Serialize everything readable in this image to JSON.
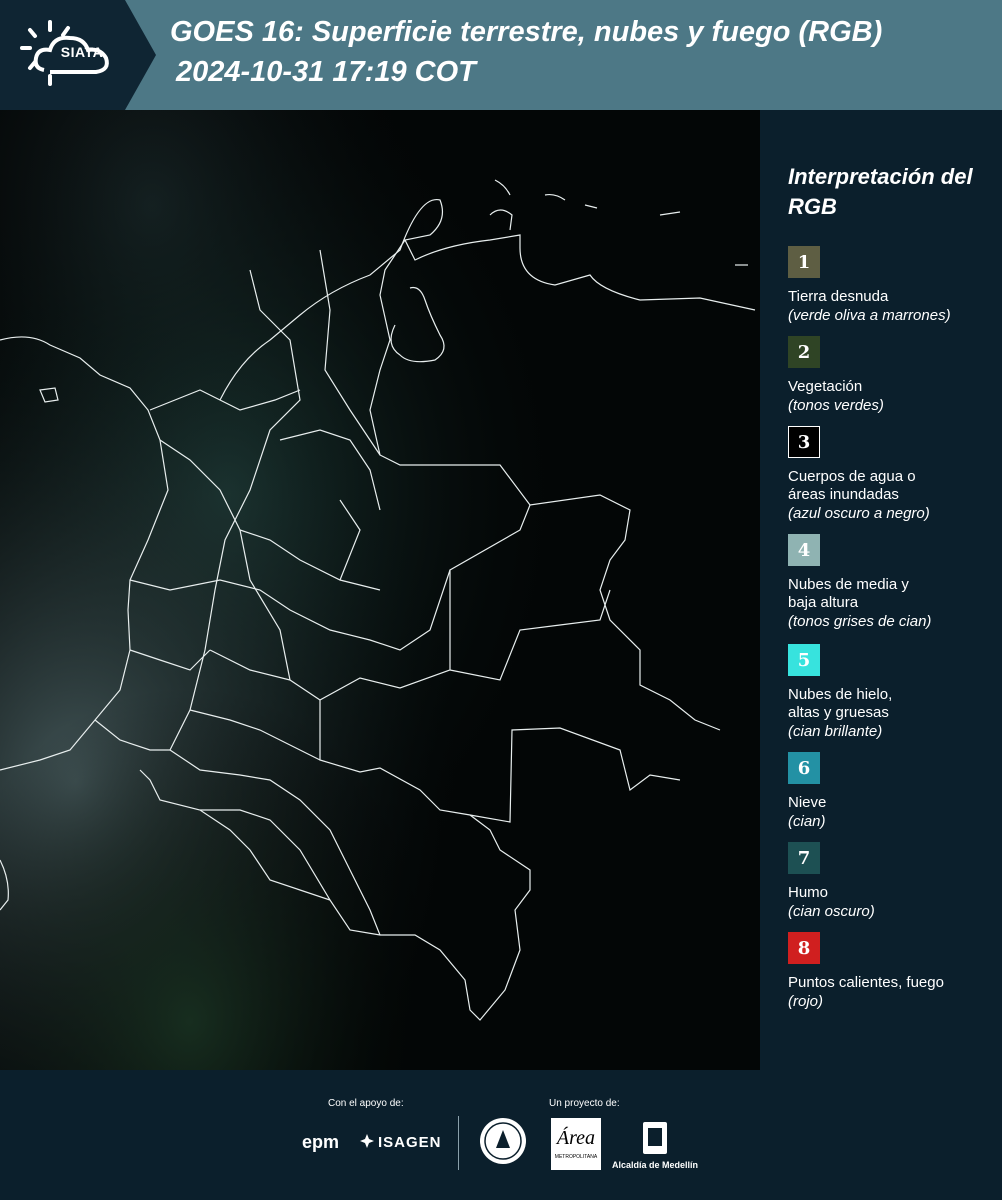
{
  "header": {
    "logo_text": "SIATA",
    "title_line1": "GOES 16: Superficie terrestre, nubes y fuego (RGB)",
    "title_line2": "2024-10-31 17:19 COT",
    "colors": {
      "band": "#4d7886",
      "logo_bg": "#0f2533"
    }
  },
  "legend": {
    "title": "Interpretación del RGB",
    "items": [
      {
        "num": "1",
        "name": "Tierra desnuda",
        "desc": "(verde oliva a marrones)",
        "color": "#5e5e43"
      },
      {
        "num": "2",
        "name": "Vegetación",
        "desc": "(tonos verdes)",
        "color": "#2f4425"
      },
      {
        "num": "3",
        "name": "Cuerpos de agua o\náreas inundadas",
        "desc": "(azul oscuro a negro)",
        "color": "#000000"
      },
      {
        "num": "4",
        "name": "Nubes de media y\nbaja altura",
        "desc": "(tonos grises de cian)",
        "color": "#8fb3b2"
      },
      {
        "num": "5",
        "name": "Nubes de hielo,\naltas y gruesas",
        "desc": "(cian brillante)",
        "color": "#37e3de"
      },
      {
        "num": "6",
        "name": "Nieve",
        "desc": "(cian)",
        "color": "#2391a4"
      },
      {
        "num": "7",
        "name": "Humo",
        "desc": "(cian oscuro)",
        "color": "#1d5053"
      },
      {
        "num": "8",
        "name": "Puntos calientes, fuego",
        "desc": "(rojo)",
        "color": "#d01f1f"
      }
    ]
  },
  "footer": {
    "support_label": "Con el apoyo de:",
    "project_label": "Un proyecto de:",
    "epm": "epm",
    "isagen": "ISAGEN",
    "area_word": "Área",
    "area_sub": "METROPOLITANA",
    "alcaldia": "Alcaldía de Medellín"
  }
}
